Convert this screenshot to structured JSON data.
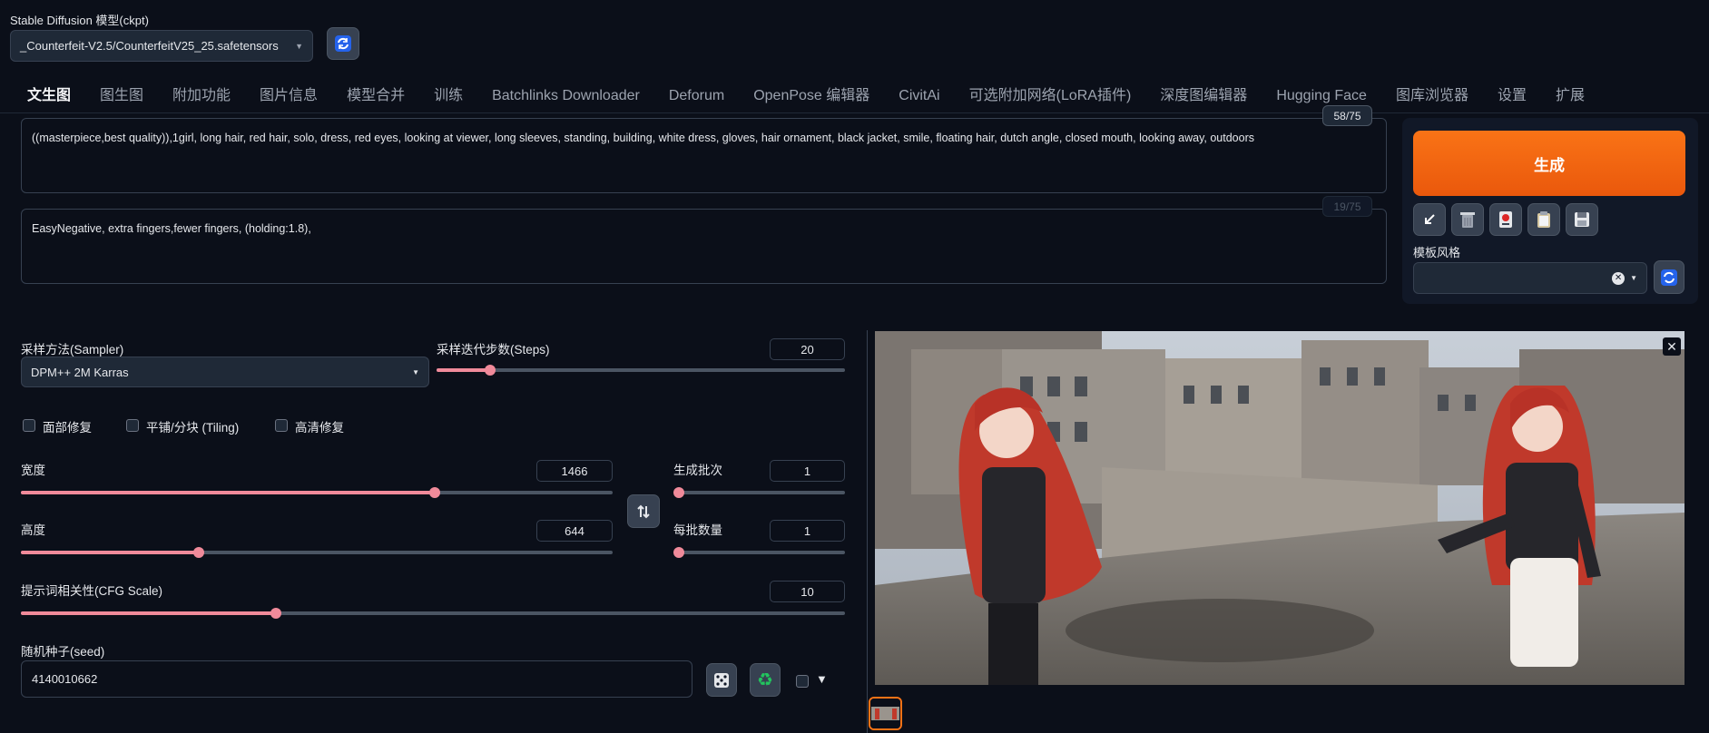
{
  "model": {
    "label": "Stable Diffusion 模型(ckpt)",
    "value": "_Counterfeit-V2.5/CounterfeitV25_25.safetensors"
  },
  "tabs": [
    {
      "label": "文生图",
      "active": true
    },
    {
      "label": "图生图"
    },
    {
      "label": "附加功能"
    },
    {
      "label": "图片信息"
    },
    {
      "label": "模型合并"
    },
    {
      "label": "训练"
    },
    {
      "label": "Batchlinks Downloader"
    },
    {
      "label": "Deforum"
    },
    {
      "label": "OpenPose 编辑器"
    },
    {
      "label": "CivitAi"
    },
    {
      "label": "可选附加网络(LoRA插件)"
    },
    {
      "label": "深度图编辑器"
    },
    {
      "label": "Hugging Face"
    },
    {
      "label": "图库浏览器"
    },
    {
      "label": "设置"
    },
    {
      "label": "扩展"
    }
  ],
  "prompt": {
    "positive": "((masterpiece,best quality)),1girl, long hair, red hair, solo, dress, red eyes, looking at viewer, long sleeves, standing, building, white dress, gloves, hair ornament, black jacket, smile, floating hair, dutch angle, closed mouth, looking away, outdoors",
    "positive_count": "58/75",
    "negative": "EasyNegative, extra fingers,fewer fingers, (holding:1.8),",
    "negative_count": "19/75"
  },
  "actions": {
    "generate_label": "生成",
    "style_label": "模板风格",
    "tool_icons": [
      "arrow-down-left-icon",
      "trash-icon",
      "red-card-icon",
      "clipboard-icon",
      "save-icon"
    ]
  },
  "sampler": {
    "label": "采样方法(Sampler)",
    "value": "DPM++ 2M Karras"
  },
  "steps": {
    "label": "采样迭代步数(Steps)",
    "value": "20",
    "fraction": 0.13
  },
  "checkboxes": {
    "face": "面部修复",
    "tiling": "平铺/分块 (Tiling)",
    "hires": "高清修复"
  },
  "width": {
    "label": "宽度",
    "value": "1466",
    "fraction": 0.7
  },
  "height": {
    "label": "高度",
    "value": "644",
    "fraction": 0.3
  },
  "batch_count": {
    "label": "生成批次",
    "value": "1",
    "fraction": 0.0
  },
  "batch_size": {
    "label": "每批数量",
    "value": "1",
    "fraction": 0.0
  },
  "cfg": {
    "label": "提示词相关性(CFG Scale)",
    "value": "10",
    "fraction": 0.31
  },
  "seed": {
    "label": "随机种子(seed)",
    "value": "4140010662",
    "extra_label": "▼"
  },
  "colors": {
    "accent": "#f97316",
    "slider": "#f08a9a",
    "background": "#0b0f19"
  }
}
